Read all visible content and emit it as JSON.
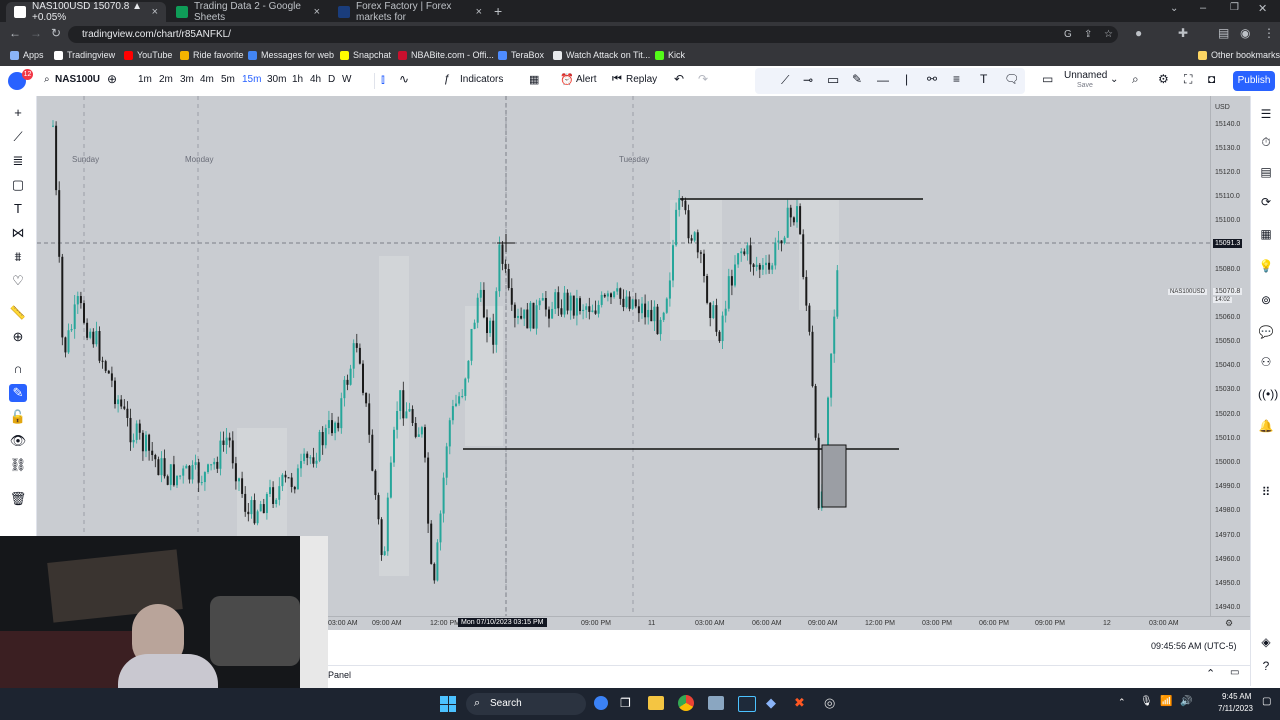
{
  "browser": {
    "tabs": [
      {
        "label": "NAS100USD 15070.8 ▲ +0.05%",
        "close": "×",
        "favicon_color": "#131722"
      },
      {
        "label": "Trading Data 2 - Google Sheets",
        "close": "×",
        "favicon_color": "#0f9d58"
      },
      {
        "label": "Forex Factory | Forex markets for",
        "close": "×",
        "favicon_color": "#1a3d7c"
      }
    ],
    "new_tab": "+",
    "url": "tradingview.com/chart/r85ANFKL/",
    "bookmarks": [
      {
        "label": "Apps",
        "icon": "apps-icon",
        "color": "#8ab4f8"
      },
      {
        "label": "Tradingview",
        "icon": "tradingview-icon",
        "color": "#ffffff"
      },
      {
        "label": "YouTube",
        "icon": "youtube-icon",
        "color": "#ff0000"
      },
      {
        "label": "Ride favorite",
        "icon": "favorite-icon",
        "color": "#f4b400"
      },
      {
        "label": "Messages for web",
        "icon": "messages-icon",
        "color": "#4285f4"
      },
      {
        "label": "Snapchat",
        "icon": "snapchat-icon",
        "color": "#fffc00"
      },
      {
        "label": "NBABite.com - Offi...",
        "icon": "nba-icon",
        "color": "#c8102e"
      },
      {
        "label": "TeraBox",
        "icon": "terabox-icon",
        "color": "#4e8cff"
      },
      {
        "label": "Watch Attack on Tit...",
        "icon": "attack-icon",
        "color": "#e8eaed"
      },
      {
        "label": "Kick",
        "icon": "kick-icon",
        "color": "#53fc18"
      }
    ],
    "other_bookmarks": "Other bookmarks"
  },
  "toolbar": {
    "notif_count": "12",
    "symbol": "NAS100U",
    "intervals": [
      "1m",
      "2m",
      "3m",
      "4m",
      "5m",
      "15m",
      "30m",
      "1h",
      "4h",
      "D",
      "W"
    ],
    "active_interval": "15m",
    "indicators": "Indicators",
    "alert": "Alert",
    "replay": "Replay",
    "layout_name": "Unnamed",
    "layout_sub": "Save",
    "publish": "Publish"
  },
  "chart": {
    "day_labels": [
      "Sunday",
      "Monday",
      "Tuesday"
    ],
    "price_axis": [
      "USD",
      "15140.0",
      "15130.0",
      "15120.0",
      "15110.0",
      "15100.0",
      "15091.3",
      "15080.0",
      "15070.8",
      "15060.0",
      "15050.0",
      "15040.0",
      "15030.0",
      "15020.0",
      "15010.0",
      "15000.0",
      "14990.0",
      "14980.0",
      "14970.0",
      "14960.0",
      "14950.0",
      "14940.0"
    ],
    "crosshair_price": "15091.3",
    "current_price": "15070.8",
    "current_countdown": "14:02",
    "symbol_tag": "NAS100USD",
    "time_axis": [
      "03:00 AM",
      "09:00 AM",
      "12:00 PM",
      "09:00 PM",
      "11",
      "03:00 AM",
      "06:00 AM",
      "09:00 AM",
      "12:00 PM",
      "03:00 PM",
      "06:00 PM",
      "09:00 PM",
      "12",
      "03:00 AM"
    ],
    "crosshair_time": "Mon 07/10/2023  03:15 PM",
    "clock": "09:45:56 AM (UTC-5)",
    "panel_label": "Panel",
    "bg_color": "#c9ccd1",
    "candle_up": "#26a69a",
    "candle_down": "#1a1a1a"
  },
  "taskbar": {
    "search": "Search",
    "time": "9:45 AM",
    "date": "7/11/2023"
  }
}
